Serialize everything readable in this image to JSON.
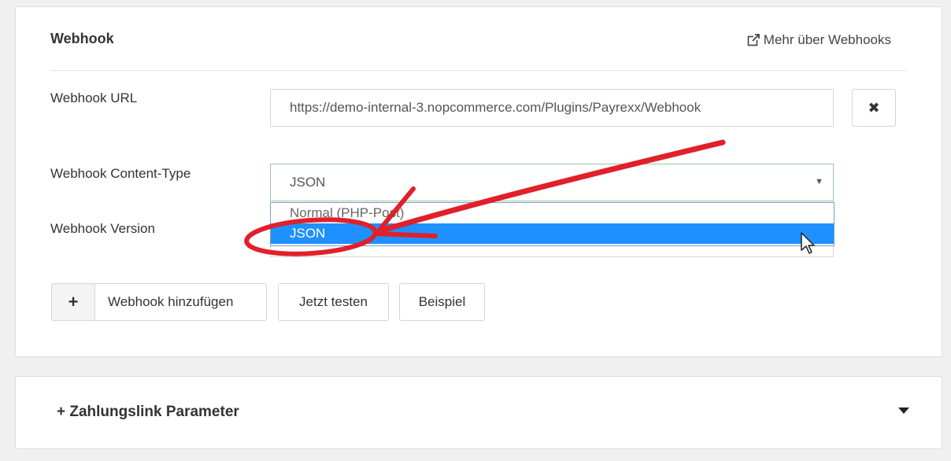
{
  "webhook": {
    "title": "Webhook",
    "more_link": "Mehr über Webhooks",
    "url_label": "Webhook URL",
    "url_value": "https://demo-internal-3.nopcommerce.com/Plugins/Payrexx/Webhook",
    "content_type_label": "Webhook Content-Type",
    "content_type_value": "JSON",
    "content_type_options": [
      "Normal (PHP-Post)",
      "JSON"
    ],
    "version_label": "Webhook Version",
    "buttons": {
      "add": "Webhook hinzufügen",
      "add_icon": "+",
      "test": "Jetzt testen",
      "example": "Beispiel"
    },
    "clear_icon": "✖"
  },
  "zahlungslink": {
    "title": "+ Zahlungslink Parameter"
  },
  "colors": {
    "highlight": "#1e90ff",
    "annotation": "#e0202a"
  }
}
